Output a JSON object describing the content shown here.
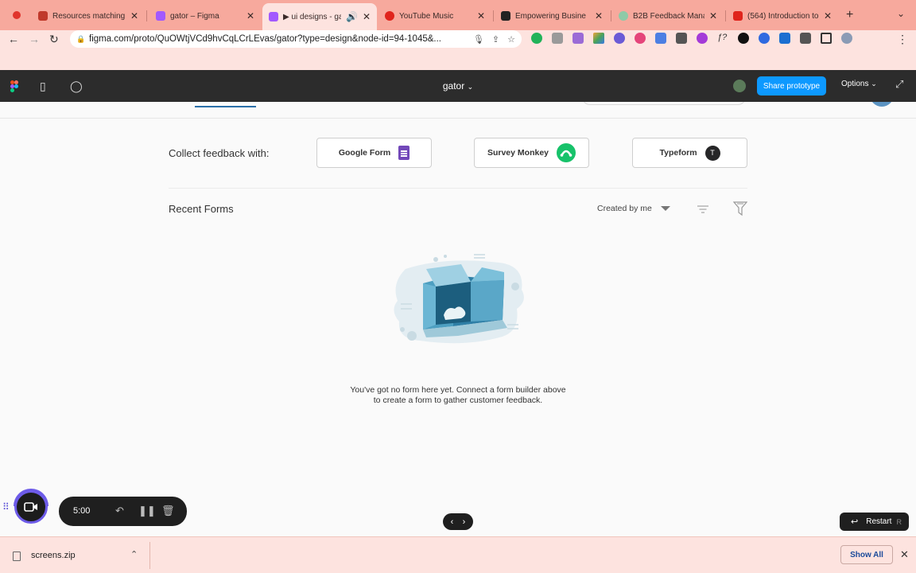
{
  "browser": {
    "tabs": [
      {
        "title": "Resources matching",
        "color": "#c0392b"
      },
      {
        "title": "gator – Figma",
        "color": "#a259ff"
      },
      {
        "title": "▶ ui designs - ga",
        "color": "#a259ff"
      },
      {
        "title": "YouTube Music",
        "color": "#e0241c"
      },
      {
        "title": "Empowering Busine",
        "color": "#222222"
      },
      {
        "title": "B2B Feedback Mana",
        "color": "#8fcaa7"
      },
      {
        "title": "(564) Introduction to",
        "color": "#e0241c"
      }
    ],
    "new_tab": "+",
    "tab_menu": "⌄",
    "url": "figma.com/proto/QuOWtjVCd9hvCqLCrLEvas/gator?type=design&node-id=94-1045&..."
  },
  "figma": {
    "file_title": "gator",
    "share_label": "Share prototype",
    "options_label": "Options"
  },
  "page": {
    "collect_label": "Collect feedback with:",
    "builders": [
      {
        "label": "Google Form",
        "icon": "google-forms-icon"
      },
      {
        "label": "Survey Monkey",
        "icon": "surveymonkey-icon"
      },
      {
        "label": "Typeform",
        "icon": "typeform-icon",
        "glyph": "T"
      }
    ],
    "recent_title": "Recent Forms",
    "filter_label": "Created by me",
    "empty_line1": "You've got no form here yet. Connect a form builder above",
    "empty_line2": "to create a form to gather customer feedback."
  },
  "recorder": {
    "timer": "5:00"
  },
  "prototype_nav": {
    "restart_label": "Restart",
    "restart_key": "R"
  },
  "downloads": {
    "file_name": "screens.zip",
    "show_all": "Show All"
  }
}
